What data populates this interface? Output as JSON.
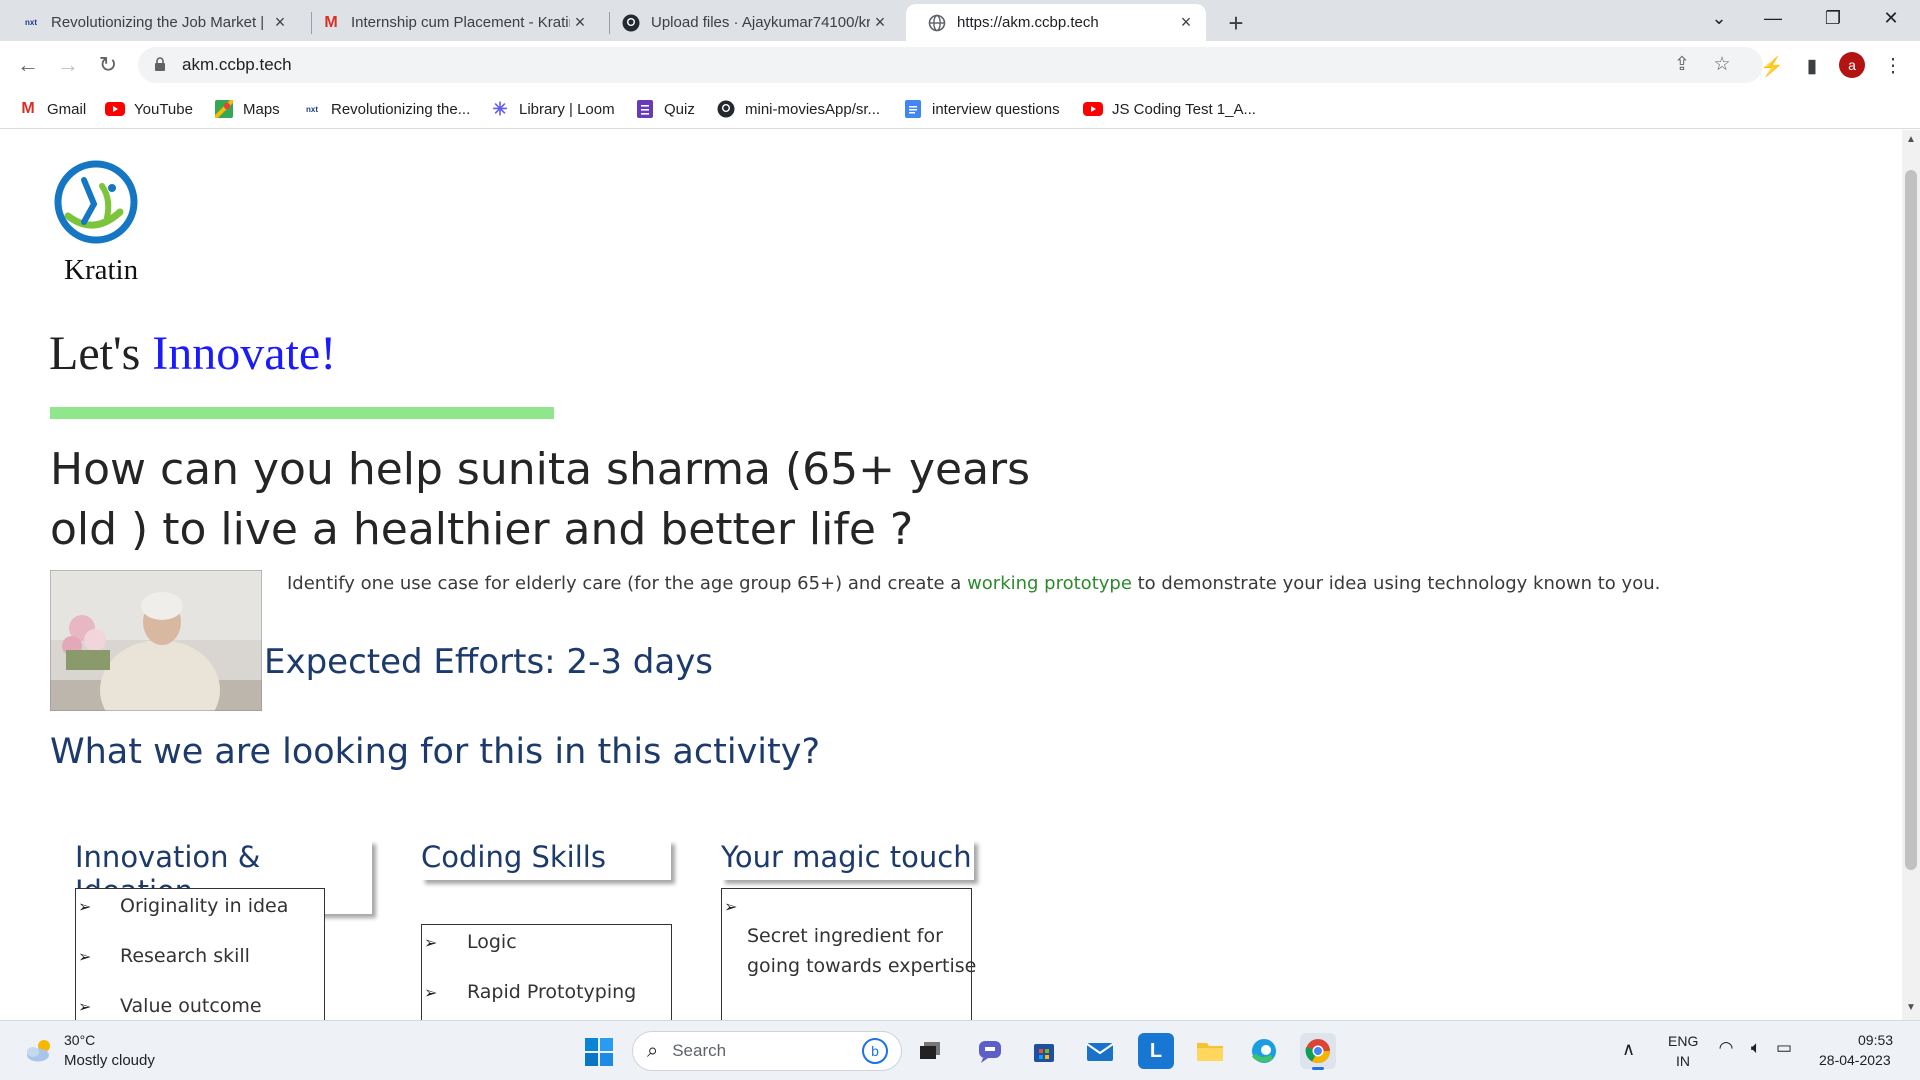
{
  "browser": {
    "tabs": [
      {
        "title": "Revolutionizing the Job Market |",
        "icon": "nxt-wave-favicon"
      },
      {
        "title": "Internship cum Placement - Kratin",
        "icon": "gmail-favicon"
      },
      {
        "title": "Upload files · Ajaykumar74100/kr",
        "icon": "github-favicon"
      },
      {
        "title": "https://akm.ccbp.tech",
        "icon": "globe-favicon"
      }
    ],
    "new_tab": "+",
    "url": "akm.ccbp.tech",
    "avatar_letter": "a",
    "bookmarks": [
      {
        "label": "Gmail",
        "icon": "gmail-icon"
      },
      {
        "label": "YouTube",
        "icon": "youtube-icon"
      },
      {
        "label": "Maps",
        "icon": "maps-icon"
      },
      {
        "label": "Revolutionizing the...",
        "icon": "nxt-wave-icon"
      },
      {
        "label": "Library | Loom",
        "icon": "loom-icon"
      },
      {
        "label": "Quiz",
        "icon": "forms-icon"
      },
      {
        "label": "mini-moviesApp/sr...",
        "icon": "github-icon"
      },
      {
        "label": "interview questions",
        "icon": "docs-icon"
      },
      {
        "label": "JS Coding Test 1_A...",
        "icon": "youtube-icon"
      }
    ]
  },
  "page": {
    "logo_text": "Kratin",
    "heading_plain": "Let's ",
    "heading_accent": "Innovate!",
    "question": "How can you help sunita sharma (65+ years old ) to live a healthier and better life ?",
    "desc_before": "Identify one use case for elderly care (for the age group 65+) and create a ",
    "desc_link": "working prototype",
    "desc_after": " to demonstrate your idea using technology known to you.",
    "efforts": "Expected Efforts: 2-3 days",
    "looking": "What we are looking for this in this activity?",
    "cards": [
      {
        "title": "Innovation & Ideation",
        "items": [
          "Originality in idea",
          "Research skill",
          "Value outcome"
        ]
      },
      {
        "title": "Coding Skills",
        "items": [
          "Logic",
          "Rapid Prototyping"
        ]
      },
      {
        "title": "Your magic touch",
        "items": [
          "Secret ingredient for",
          "going towards expertise"
        ]
      }
    ],
    "bullet": "➢"
  },
  "taskbar": {
    "temp": "30°C",
    "weather": "Mostly cloudy",
    "search": "Search",
    "lang1": "ENG",
    "lang2": "IN",
    "time": "09:53",
    "date": "28-04-2023"
  },
  "colors": {
    "accent_blue": "#1a1aff",
    "heading_navy": "#1c3a6b",
    "green_bar": "#90e68a",
    "link_green": "#2b8a2b"
  }
}
